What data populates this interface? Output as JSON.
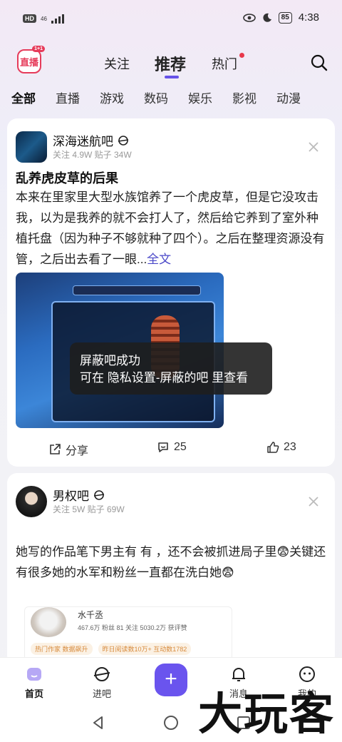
{
  "status_bar": {
    "network": "HD",
    "sig_small": "46",
    "time": "4:38",
    "battery": "85"
  },
  "topnav": {
    "logo": "直播",
    "logo_badge": "1+1",
    "tabs": [
      "关注",
      "推荐",
      "热门"
    ],
    "active_tab": "推荐"
  },
  "categories": [
    "全部",
    "直播",
    "游戏",
    "数码",
    "娱乐",
    "影视",
    "动漫"
  ],
  "post1": {
    "forum_name": "深海迷航吧",
    "stats": "关注 4.9W  贴子 34W",
    "title": "乱养虎皮草的后果",
    "body": "本来在里家里大型水族馆养了一个虎皮草，但是它没攻击我，以为是我养的就不会打人了，然后给它养到了室外种植托盘（因为种子不够就种了四个）。之后在整理资源没有管，之后出去看了一眼...",
    "more": "全文",
    "share": "分享",
    "comments": "25",
    "likes": "23"
  },
  "toast": {
    "line1": "屏蔽吧成功",
    "line2": "可在 隐私设置-屏蔽的吧 里查看"
  },
  "post2": {
    "forum_name": "男权吧",
    "stats": "关注 5W  贴子 69W",
    "body": "她写的作品笔下男主有        有      ，还不会被抓进局子里😨关键还有很多她的水军和粉丝一直都在洗白她😨",
    "quote": {
      "name": "水千丞",
      "stats": "467.6万 粉丝     81 关注     5030.2万 获评赞",
      "tags": [
        "热门作家  数据飙升",
        "昨日阅读数10万+  互动数1782"
      ]
    }
  },
  "bottomnav": {
    "items": [
      "首页",
      "进吧",
      "",
      "消息",
      "我的"
    ]
  },
  "watermark": "大玩客"
}
